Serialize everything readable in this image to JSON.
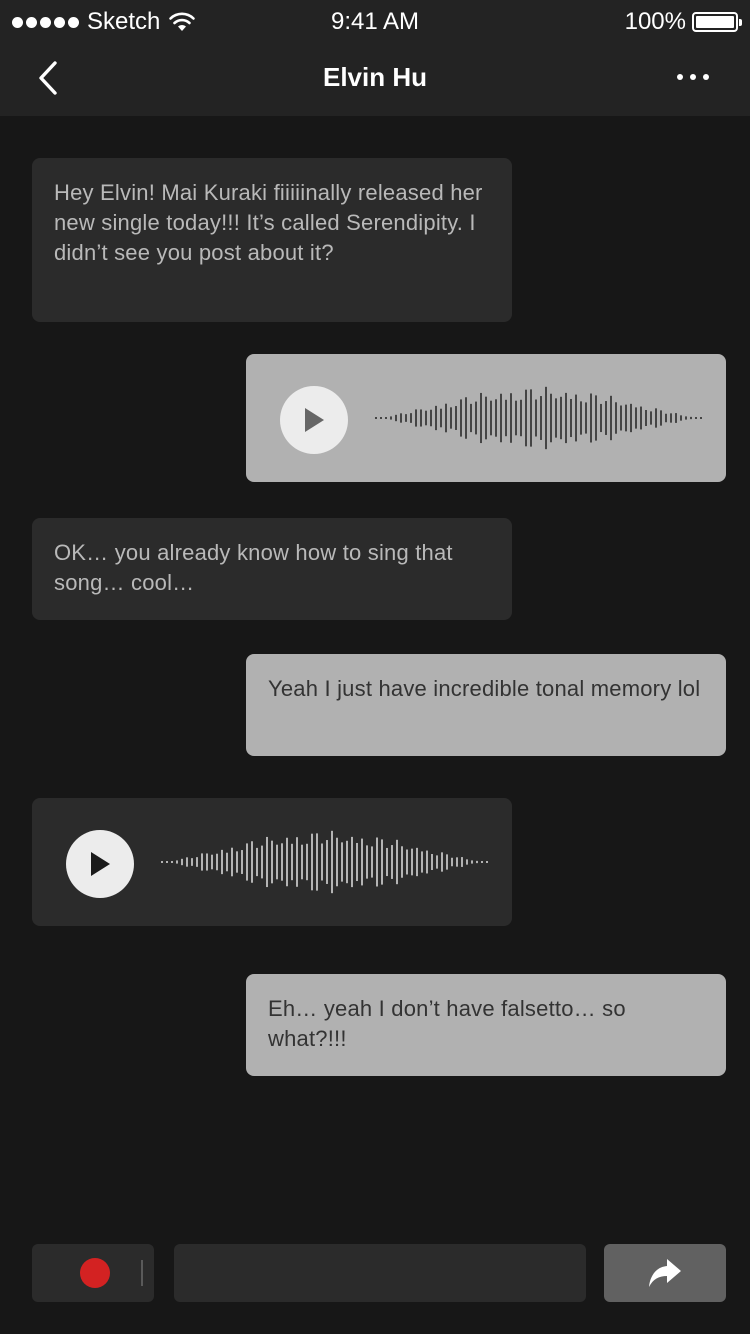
{
  "status_bar": {
    "carrier": "Sketch",
    "time": "9:41 AM",
    "battery": "100%",
    "icons": [
      "signal-dots-icon",
      "wifi-icon",
      "battery-icon"
    ]
  },
  "nav": {
    "title": "Elvin Hu",
    "icons": [
      "back-chevron-icon",
      "more-dots-icon"
    ]
  },
  "messages": [
    {
      "direction": "incoming",
      "type": "text",
      "text": "Hey Elvin! Mai Kuraki fiiiiinally released her new single today!!! It’s called Serendipity. I didn’t see you post about it?"
    },
    {
      "direction": "outgoing",
      "type": "voice"
    },
    {
      "direction": "incoming",
      "type": "text",
      "text": "OK… you already know how to sing that song… cool…"
    },
    {
      "direction": "outgoing",
      "type": "text",
      "text": "Yeah I just have incredible tonal memory lol"
    },
    {
      "direction": "incoming",
      "type": "voice"
    },
    {
      "direction": "outgoing",
      "type": "text",
      "text": "Eh… yeah I don’t have falsetto… so what?!!!"
    }
  ],
  "composer": {
    "input_value": "",
    "placeholder": "",
    "icons": [
      "record-icon",
      "send-arrow-icon"
    ]
  },
  "colors": {
    "background": "#171717",
    "bar": "#232323",
    "incoming_bubble": "#2b2b2b",
    "outgoing_bubble": "#b1b1b1",
    "record": "#d32222",
    "send_button": "#616161"
  }
}
